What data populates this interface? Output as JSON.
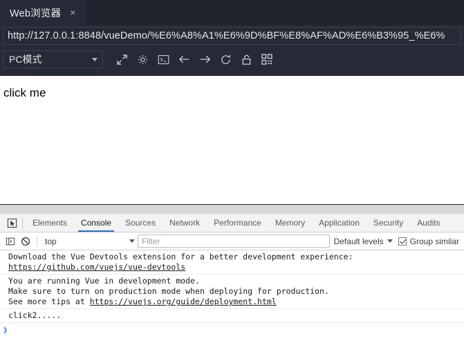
{
  "browser": {
    "tab": {
      "title": "Web浏览器",
      "close_label": "×"
    },
    "address_bar": {
      "value": "http://127.0.0.1:8848/vueDemo/%E6%A8%A1%E6%9D%BF%E8%AF%AD%E6%B3%95_%E6%"
    },
    "mode_select": {
      "value": "PC模式"
    },
    "toolbar_icons": [
      {
        "name": "popout-icon"
      },
      {
        "name": "gear-icon"
      },
      {
        "name": "console-icon"
      },
      {
        "name": "back-arrow-icon"
      },
      {
        "name": "forward-arrow-icon"
      },
      {
        "name": "reload-icon"
      },
      {
        "name": "unlock-icon"
      },
      {
        "name": "qr-code-icon"
      }
    ]
  },
  "page": {
    "content_text": "click me"
  },
  "devtools": {
    "tabs": [
      {
        "label": "Elements",
        "active": false
      },
      {
        "label": "Console",
        "active": true
      },
      {
        "label": "Sources",
        "active": false
      },
      {
        "label": "Network",
        "active": false
      },
      {
        "label": "Performance",
        "active": false
      },
      {
        "label": "Memory",
        "active": false
      },
      {
        "label": "Application",
        "active": false
      },
      {
        "label": "Security",
        "active": false
      },
      {
        "label": "Audits",
        "active": false
      }
    ],
    "console_toolbar": {
      "context_value": "top",
      "filter_placeholder": "Filter",
      "filter_value": "",
      "levels_label": "Default levels",
      "group_similar_label": "Group similar",
      "group_similar_checked": true
    },
    "messages": [
      {
        "lines": [
          {
            "text": "Download the Vue Devtools extension for a better development experience:",
            "link": false
          },
          {
            "text": "https://github.com/vuejs/vue-devtools",
            "link": true
          }
        ]
      },
      {
        "lines": [
          {
            "text": "You are running Vue in development mode.",
            "link": false
          },
          {
            "text": "Make sure to turn on production mode when deploying for production.",
            "link": false
          },
          {
            "text": "See more tips at ",
            "link": false,
            "suffix_link": "https://vuejs.org/guide/deployment.html"
          }
        ]
      },
      {
        "lines": [
          {
            "text": "click2.....",
            "link": false
          }
        ]
      }
    ],
    "prompt": {
      "caret": "❯"
    }
  },
  "colors": {
    "chrome_bg": "#252a36",
    "tabstrip_bg": "#1f232e",
    "accent": "#1a73e8",
    "prompt_blue": "#2d6cdf",
    "splitter": "#d8d8d8"
  }
}
